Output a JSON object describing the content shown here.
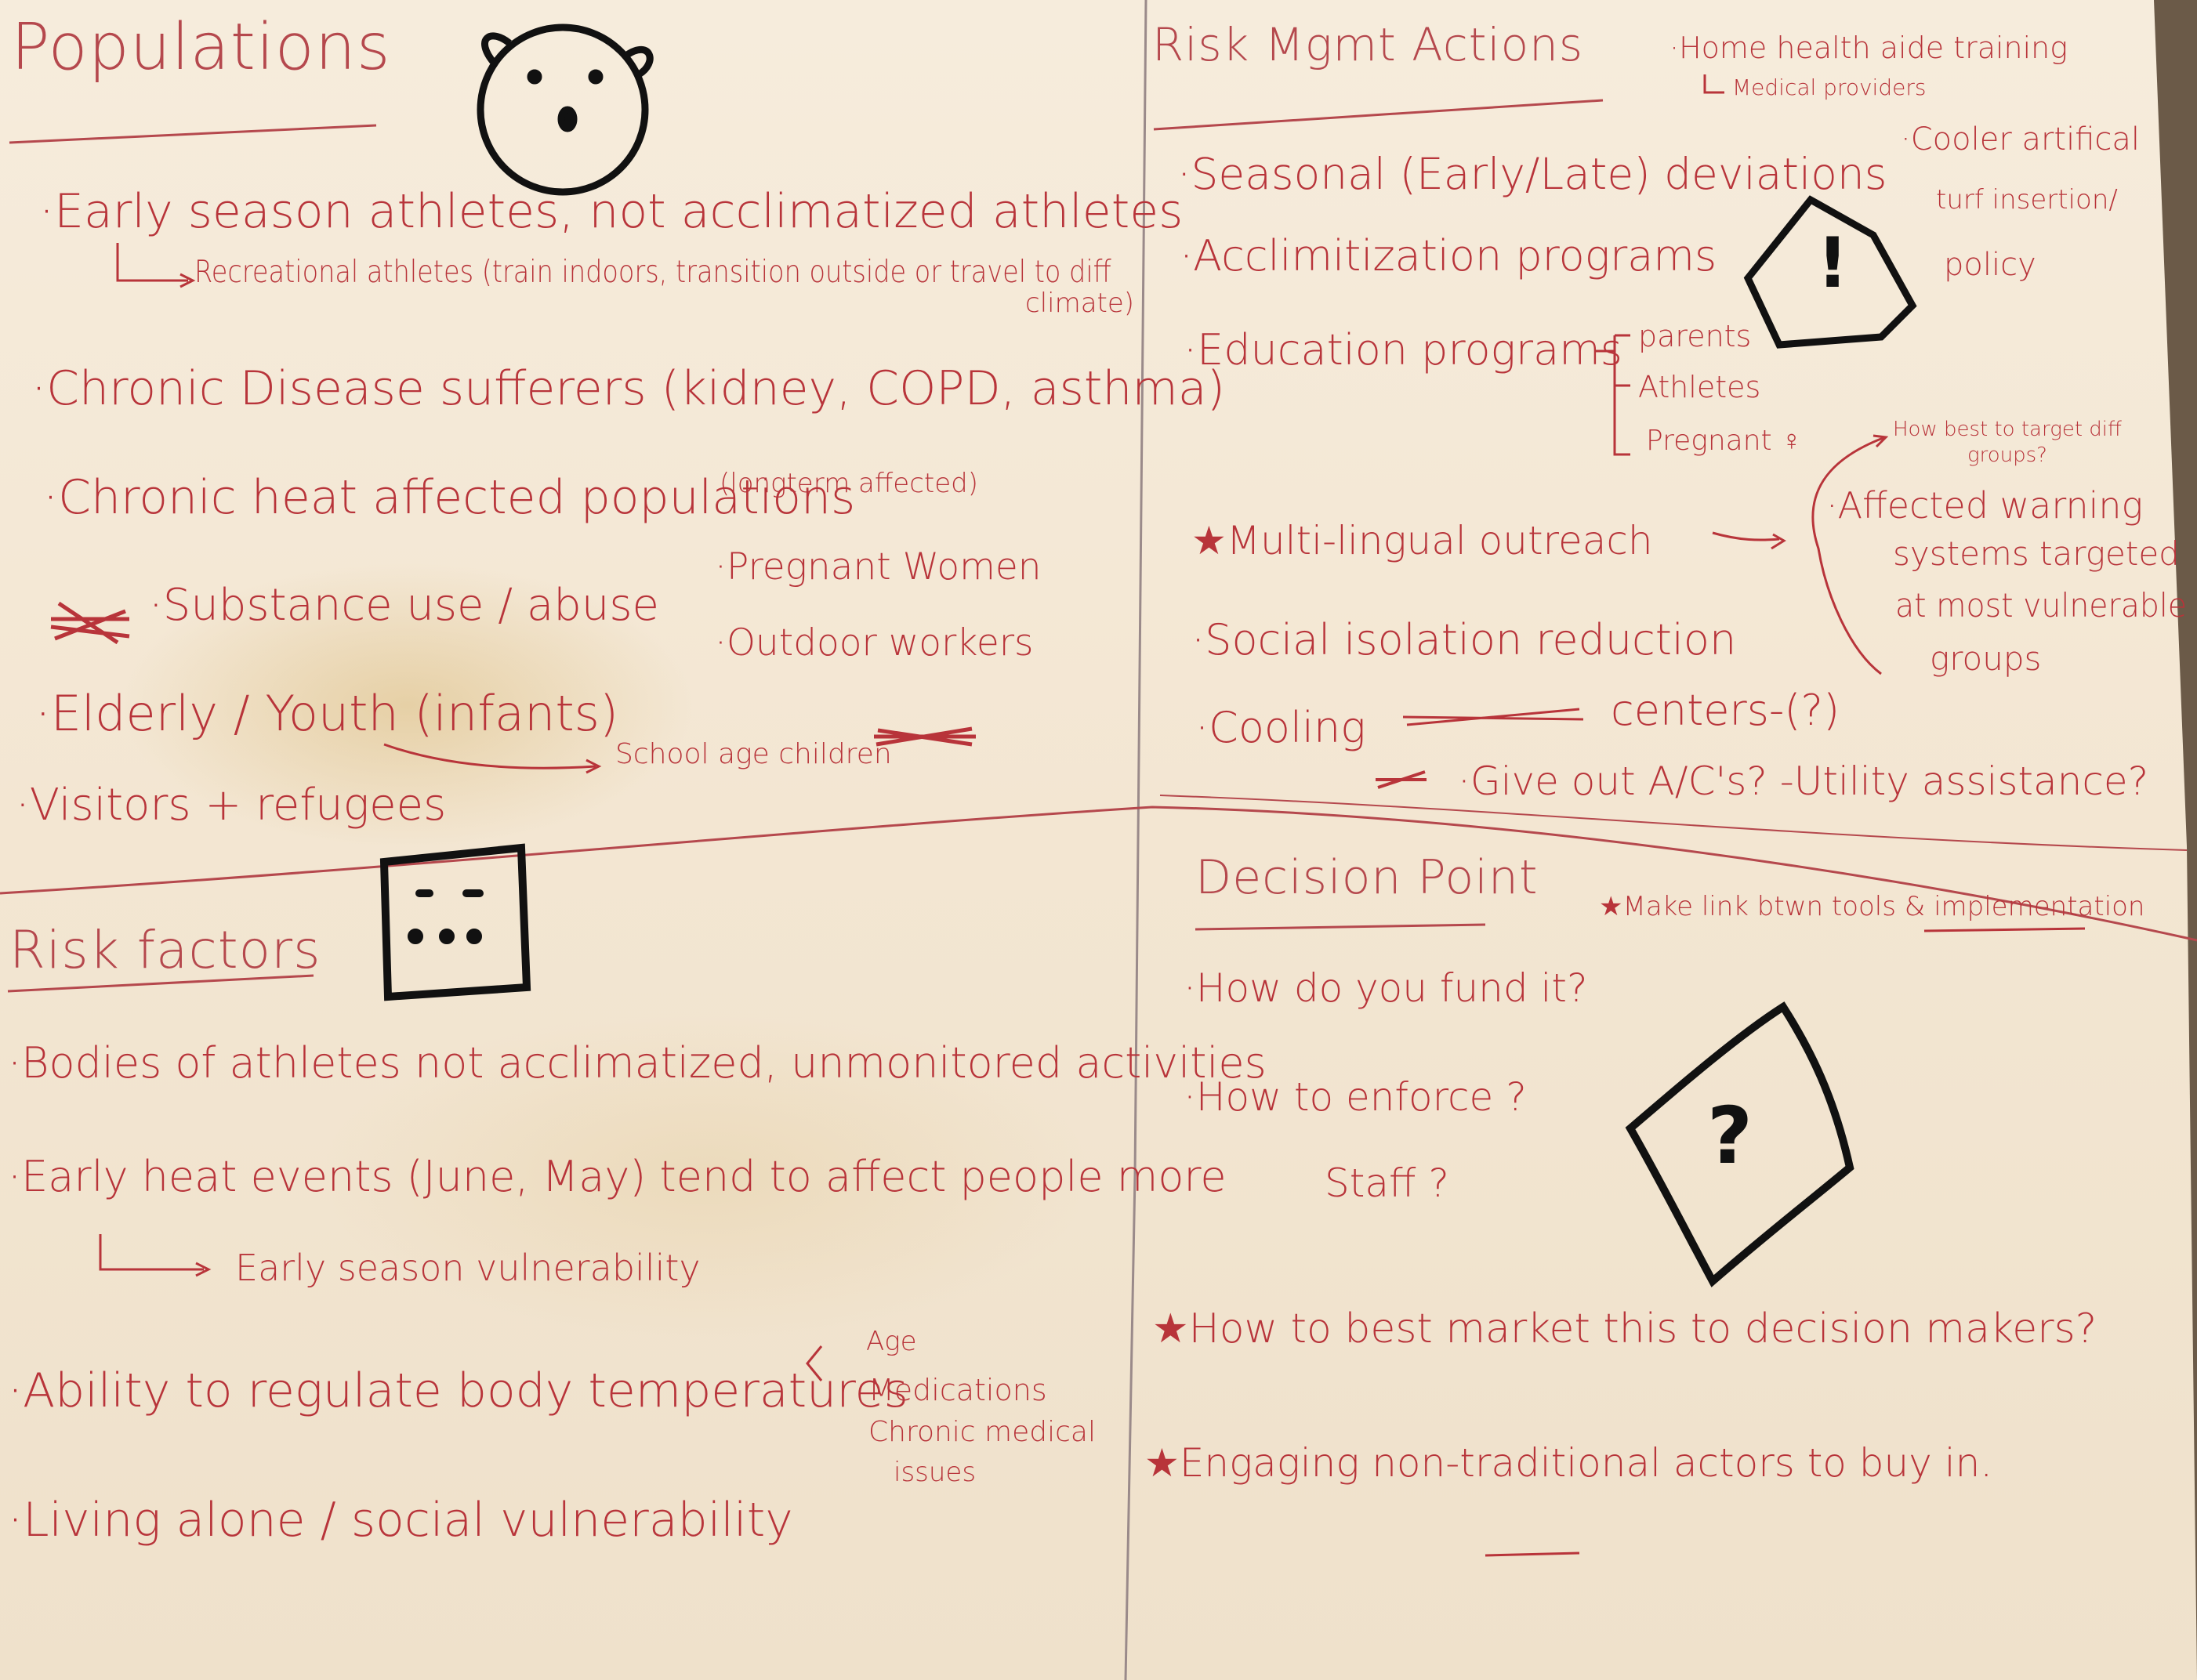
{
  "sections": {
    "populations": {
      "title": "Populations",
      "items": [
        "·Early season athletes, not acclimatized athletes",
        "Recreational athletes (train indoors, transition outside or travel to diff",
        "climate)",
        "·Chronic Disease sufferers (kidney, COPD, asthma)",
        "·Chronic heat affected populations",
        "(longterm affected)",
        "·Substance use / abuse",
        "·Pregnant Women",
        "·Outdoor workers",
        "·Elderly / Youth (infants)",
        "School age children",
        "·Visitors + refugees"
      ]
    },
    "risk_mgmt": {
      "title": "Risk Mgmt Actions",
      "items": [
        "·Home health aide training",
        "Medical providers",
        "·Seasonal (Early/Late) deviations",
        "·Cooler artifical",
        "turf insertion/",
        "policy",
        "·Acclimitization programs",
        "·Education programs",
        "parents",
        "Athletes",
        "Pregnant ♀",
        "How best to target diff",
        "groups?",
        "★Multi-lingual outreach",
        "·Affected warning",
        "systems targeted",
        "at most vulnerable",
        "groups",
        "·Social isolation reduction",
        "·Cooling",
        "centers-(?)",
        "·Give out A/C's? -Utility assistance?"
      ]
    },
    "risk_factors": {
      "title": "Risk factors",
      "items": [
        "·Bodies of athletes not acclimatized, unmonitored activities",
        "·Early heat events (June, May) tend to affect people more",
        "Early season vulnerability",
        "·Ability to regulate body temperatures",
        "Age",
        "Medications",
        "Chronic medical",
        "issues",
        "·Living alone / social vulnerability"
      ]
    },
    "decision_point": {
      "title": "Decision Point",
      "items": [
        "★Make link btwn tools & implementation",
        "·How do you fund it?",
        "·How to enforce ?",
        "Staff ?",
        "★How to best market this to decision makers?",
        "★Engaging non-traditional actors to buy in."
      ]
    }
  },
  "icons": {
    "bear_face": "bear-face-icon",
    "alert_pentagon": "exclamation-pentagon-icon",
    "dice_square": "dice-square-icon",
    "question_diamond": "question-diamond-icon",
    "exclamation_glyph": "!",
    "question_glyph": "?"
  },
  "colors": {
    "ink_red": "#b8343a",
    "ink_black": "#111111",
    "paper": "#f4e8d5"
  }
}
